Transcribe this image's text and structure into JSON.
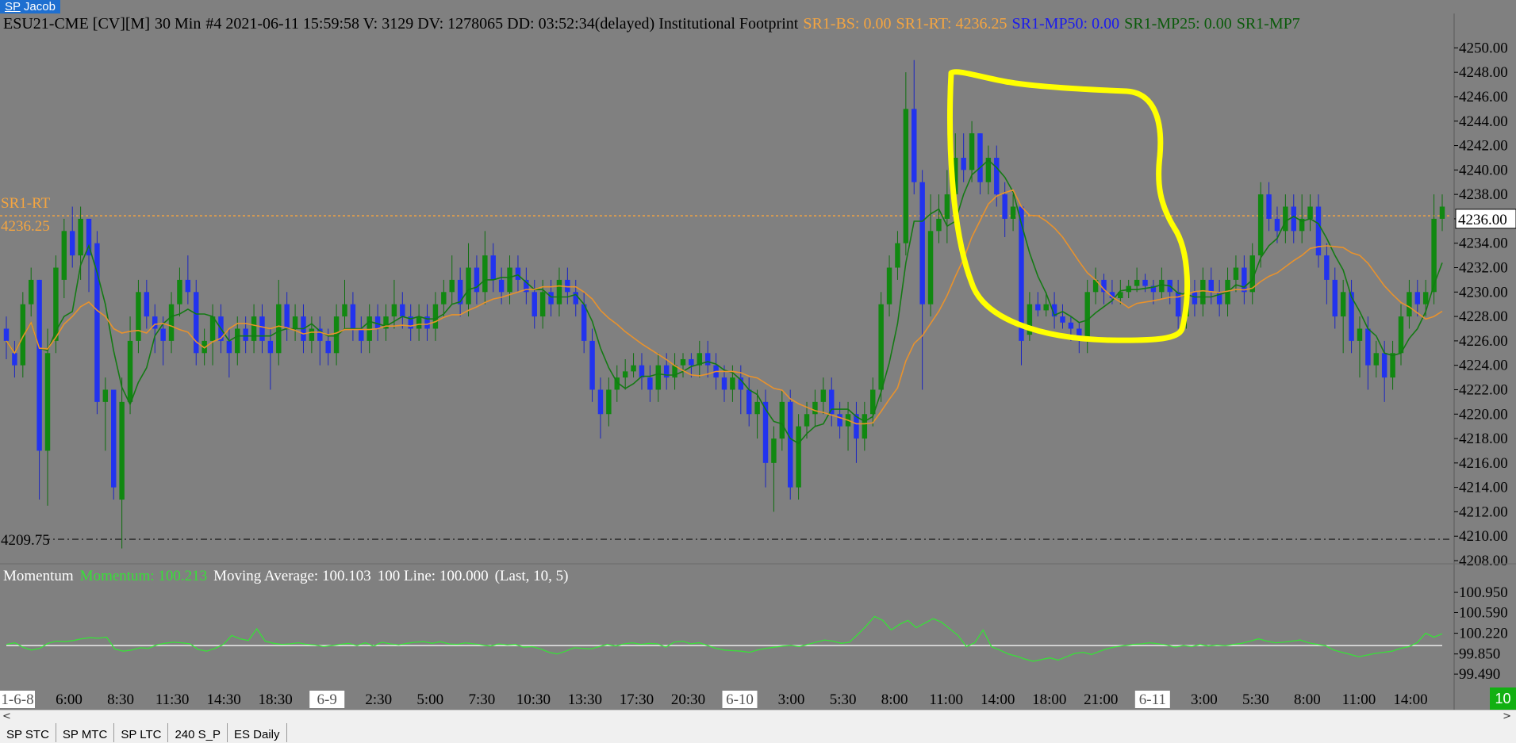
{
  "tab_title": {
    "prefix": "SP",
    "name": "Jacob"
  },
  "header": {
    "symbol": "ESU21-CME [CV][M]",
    "interval": "30 Min",
    "info": "#4 2021-06-11 15:59:58 V: 3129 DV: 1278065 DD: 03:52:34(delayed) Institutional Footprint",
    "sr1_bs": "SR1-BS: 0.00",
    "sr1_rt": "SR1-RT: 4236.25",
    "sr1_mp50": "SR1-MP50: 0.00",
    "sr1_mp25": "SR1-MP25: 0.00",
    "sr1_mp7": "SR1-MP7"
  },
  "colors": {
    "background": "#808080",
    "up_candle": "#118811",
    "down_candle": "#2233ee",
    "fast_ma": "#147a14",
    "slow_ma": "#e8922c",
    "sr_line": "#f5a540",
    "momentum_line": "#38e038",
    "annotation": "#ffff00"
  },
  "price_axis": {
    "min": 4208,
    "max": 4251,
    "labels": [
      "4250.00",
      "4248.00",
      "4246.00",
      "4244.00",
      "4242.00",
      "4240.00",
      "4238.00",
      "4236.00",
      "4234.00",
      "4232.00",
      "4230.00",
      "4228.00",
      "4226.00",
      "4224.00",
      "4222.00",
      "4220.00",
      "4218.00",
      "4216.00",
      "4214.00",
      "4212.00",
      "4210.00",
      "4208.00"
    ],
    "current_price": "4236.00"
  },
  "levels": {
    "sr_rt_label": "SR1-RT",
    "sr_rt_value": "4236.25",
    "sr_rt_price": 4236.25,
    "support_label": "4209.75",
    "support_price": 4209.75
  },
  "momentum": {
    "title": "Momentum",
    "value_label": "Momentum: 100.213",
    "ma_label": "Moving Average: 100.103",
    "line_label": "100 Line: 100.000",
    "params": "(Last, 10, 5)",
    "axis_labels": [
      "100.950",
      "100.590",
      "100.220",
      "99.850",
      "99.490"
    ],
    "min": 99.35,
    "max": 101.05,
    "baseline": 100.0
  },
  "time_axis": {
    "labels": [
      {
        "text": "1-6-8",
        "boxed": true
      },
      {
        "text": "6:00",
        "boxed": false
      },
      {
        "text": "8:30",
        "boxed": false
      },
      {
        "text": "11:30",
        "boxed": false
      },
      {
        "text": "14:30",
        "boxed": false
      },
      {
        "text": "18:30",
        "boxed": false
      },
      {
        "text": "6-9",
        "boxed": true
      },
      {
        "text": "2:30",
        "boxed": false
      },
      {
        "text": "5:00",
        "boxed": false
      },
      {
        "text": "7:30",
        "boxed": false
      },
      {
        "text": "10:30",
        "boxed": false
      },
      {
        "text": "13:30",
        "boxed": false
      },
      {
        "text": "17:30",
        "boxed": false
      },
      {
        "text": "20:30",
        "boxed": false
      },
      {
        "text": "6-10",
        "boxed": true
      },
      {
        "text": "3:00",
        "boxed": false
      },
      {
        "text": "5:30",
        "boxed": false
      },
      {
        "text": "8:00",
        "boxed": false
      },
      {
        "text": "11:00",
        "boxed": false
      },
      {
        "text": "14:00",
        "boxed": false
      },
      {
        "text": "18:00",
        "boxed": false
      },
      {
        "text": "21:00",
        "boxed": false
      },
      {
        "text": "6-11",
        "boxed": true
      },
      {
        "text": "3:00",
        "boxed": false
      },
      {
        "text": "5:30",
        "boxed": false
      },
      {
        "text": "8:00",
        "boxed": false
      },
      {
        "text": "11:00",
        "boxed": false
      },
      {
        "text": "14:00",
        "boxed": false
      }
    ]
  },
  "chart_data": {
    "type": "candlestick",
    "bars": [
      [
        4227,
        4226,
        4228,
        4224.5
      ],
      [
        4225,
        4224,
        4226,
        4223
      ],
      [
        4224,
        4229,
        4230,
        4223
      ],
      [
        4229,
        4231,
        4232,
        4228
      ],
      [
        4231,
        4217,
        4231,
        4213
      ],
      [
        4217,
        4225,
        4227,
        4212.5
      ],
      [
        4226,
        4232,
        4233,
        4225
      ],
      [
        4231,
        4235,
        4236,
        4229.5
      ],
      [
        4235,
        4233,
        4237,
        4232
      ],
      [
        4233,
        4236,
        4237,
        4231
      ],
      [
        4236,
        4233,
        4235,
        4230
      ],
      [
        4234,
        4221,
        4235,
        4220
      ],
      [
        4221,
        4222,
        4223,
        4217
      ],
      [
        4222,
        4214,
        4222,
        4213
      ],
      [
        4213,
        4221,
        4223,
        4209
      ],
      [
        4221,
        4226,
        4228,
        4220
      ],
      [
        4226,
        4230,
        4231,
        4225
      ],
      [
        4230,
        4228,
        4231,
        4227
      ],
      [
        4228,
        4227,
        4229,
        4225
      ],
      [
        4227,
        4226,
        4228,
        4224
      ],
      [
        4226,
        4229,
        4230,
        4225
      ],
      [
        4229,
        4231,
        4232,
        4228
      ],
      [
        4231,
        4230,
        4233,
        4229
      ],
      [
        4230,
        4225,
        4231,
        4224
      ],
      [
        4225,
        4226,
        4227,
        4224
      ],
      [
        4226,
        4228,
        4229,
        4224
      ],
      [
        4228,
        4226,
        4229,
        4225
      ],
      [
        4226,
        4225,
        4227,
        4223
      ],
      [
        4225,
        4227,
        4228,
        4224
      ],
      [
        4227,
        4226,
        4228,
        4225
      ],
      [
        4226,
        4228,
        4229,
        4225
      ],
      [
        4228,
        4226,
        4229,
        4225
      ],
      [
        4226,
        4225,
        4227,
        4222
      ],
      [
        4225,
        4229,
        4231,
        4224
      ],
      [
        4229,
        4227,
        4230,
        4226
      ],
      [
        4227,
        4228,
        4229,
        4226
      ],
      [
        4228,
        4226,
        4229,
        4225
      ],
      [
        4226,
        4227,
        4228,
        4225
      ],
      [
        4227,
        4226,
        4228,
        4224
      ],
      [
        4226,
        4225,
        4227,
        4224
      ],
      [
        4225,
        4228,
        4229,
        4224
      ],
      [
        4228,
        4229,
        4231,
        4227
      ],
      [
        4229,
        4227,
        4230,
        4226
      ],
      [
        4227,
        4226,
        4228,
        4225
      ],
      [
        4226,
        4228,
        4229,
        4225
      ],
      [
        4228,
        4227,
        4229,
        4226
      ],
      [
        4227,
        4228,
        4229,
        4226
      ],
      [
        4228,
        4229,
        4231,
        4227
      ],
      [
        4229,
        4228,
        4230,
        4227
      ],
      [
        4228,
        4227,
        4229,
        4226
      ],
      [
        4227,
        4228,
        4229,
        4226
      ],
      [
        4228,
        4227,
        4229,
        4226
      ],
      [
        4227,
        4229,
        4230,
        4226
      ],
      [
        4229,
        4230,
        4231,
        4228
      ],
      [
        4230,
        4231,
        4233,
        4229
      ],
      [
        4231,
        4229,
        4232,
        4228
      ],
      [
        4229,
        4232,
        4234,
        4228
      ],
      [
        4232,
        4230,
        4233,
        4229
      ],
      [
        4230,
        4233,
        4235,
        4229
      ],
      [
        4233,
        4231,
        4234,
        4230
      ],
      [
        4231,
        4230,
        4232,
        4229
      ],
      [
        4230,
        4232,
        4233,
        4229
      ],
      [
        4232,
        4231,
        4233,
        4230
      ],
      [
        4231,
        4230,
        4232,
        4229
      ],
      [
        4230,
        4228,
        4231,
        4227
      ],
      [
        4228,
        4230,
        4231,
        4227
      ],
      [
        4230,
        4229,
        4231,
        4228
      ],
      [
        4229,
        4231,
        4232,
        4228
      ],
      [
        4231,
        4230,
        4232,
        4229
      ],
      [
        4230,
        4229,
        4231,
        4228
      ],
      [
        4229,
        4226,
        4230,
        4225
      ],
      [
        4226,
        4222,
        4227,
        4221
      ],
      [
        4222,
        4220,
        4223,
        4218
      ],
      [
        4220,
        4222,
        4223,
        4219
      ],
      [
        4222,
        4223,
        4224,
        4221
      ],
      [
        4223,
        4223.5,
        4224.5,
        4222
      ],
      [
        4223.5,
        4224,
        4225,
        4223
      ],
      [
        4224,
        4223,
        4225,
        4222
      ],
      [
        4223,
        4222,
        4224,
        4221
      ],
      [
        4222,
        4224,
        4225,
        4221
      ],
      [
        4224,
        4223,
        4225,
        4222
      ],
      [
        4223,
        4224,
        4225,
        4222
      ],
      [
        4224,
        4224.5,
        4225,
        4223
      ],
      [
        4224.5,
        4224,
        4225,
        4223
      ],
      [
        4224,
        4225,
        4226,
        4223
      ],
      [
        4225,
        4224,
        4226,
        4223
      ],
      [
        4224,
        4223,
        4225,
        4222
      ],
      [
        4223,
        4222,
        4224,
        4221
      ],
      [
        4222,
        4223,
        4224,
        4221
      ],
      [
        4223,
        4222,
        4224,
        4220
      ],
      [
        4222,
        4220,
        4223,
        4219
      ],
      [
        4220,
        4221,
        4222,
        4218
      ],
      [
        4221,
        4216,
        4222,
        4214
      ],
      [
        4216,
        4218,
        4219,
        4212
      ],
      [
        4218,
        4221,
        4222,
        4217
      ],
      [
        4221,
        4214,
        4222,
        4213
      ],
      [
        4214,
        4219,
        4220,
        4213
      ],
      [
        4219,
        4220,
        4221,
        4218
      ],
      [
        4220,
        4221,
        4222,
        4219
      ],
      [
        4221,
        4222,
        4223,
        4220
      ],
      [
        4222,
        4220,
        4223,
        4219
      ],
      [
        4220,
        4219,
        4221,
        4218
      ],
      [
        4219,
        4220,
        4221,
        4217
      ],
      [
        4220,
        4218,
        4221,
        4216
      ],
      [
        4218,
        4220,
        4221,
        4217
      ],
      [
        4220,
        4222,
        4223,
        4219
      ],
      [
        4222,
        4229,
        4230,
        4221
      ],
      [
        4229,
        4232,
        4233,
        4228
      ],
      [
        4232,
        4234,
        4235,
        4231
      ],
      [
        4234,
        4245,
        4248,
        4233
      ],
      [
        4245,
        4239,
        4249,
        4238
      ],
      [
        4239,
        4229,
        4240,
        4222
      ],
      [
        4229,
        4235,
        4238,
        4228
      ],
      [
        4235,
        4236,
        4238,
        4234
      ],
      [
        4236,
        4238,
        4240,
        4234
      ],
      [
        4238,
        4241,
        4243,
        4236
      ],
      [
        4241,
        4240,
        4243,
        4239
      ],
      [
        4240,
        4243,
        4244,
        4239
      ],
      [
        4243,
        4239,
        4243,
        4238
      ],
      [
        4239,
        4241,
        4242,
        4238
      ],
      [
        4241,
        4238,
        4242,
        4237
      ],
      [
        4238,
        4236,
        4239,
        4234.5
      ],
      [
        4236,
        4237,
        4238,
        4235
      ],
      [
        4237,
        4226,
        4237,
        4224
      ],
      [
        4226.5,
        4229,
        4230,
        4226
      ],
      [
        4229,
        4228.5,
        4230,
        4228
      ],
      [
        4228.5,
        4229,
        4230,
        4228
      ],
      [
        4229,
        4228,
        4230,
        4227
      ],
      [
        4228,
        4227.5,
        4229,
        4227
      ],
      [
        4227.5,
        4227,
        4228,
        4226
      ],
      [
        4227,
        4226,
        4227.5,
        4225
      ],
      [
        4226,
        4230,
        4231,
        4225
      ],
      [
        4230,
        4231,
        4232,
        4229
      ],
      [
        4231,
        4230,
        4231.5,
        4229
      ],
      [
        4230,
        4229.5,
        4231,
        4229
      ],
      [
        4229.5,
        4230,
        4231,
        4229
      ],
      [
        4230,
        4230.5,
        4231,
        4229.5
      ],
      [
        4230.5,
        4231,
        4232,
        4230
      ],
      [
        4231,
        4230.5,
        4231.5,
        4230
      ],
      [
        4230.5,
        4230,
        4231,
        4229
      ],
      [
        4230,
        4231,
        4232,
        4229.5
      ],
      [
        4231,
        4230,
        4231,
        4229
      ],
      [
        4230,
        4228,
        4231,
        4227
      ],
      [
        4228,
        4230,
        4231,
        4227
      ],
      [
        4230,
        4229,
        4231,
        4228
      ],
      [
        4229,
        4231,
        4232,
        4228
      ],
      [
        4231,
        4230,
        4232,
        4229
      ],
      [
        4230,
        4229,
        4231,
        4228
      ],
      [
        4229,
        4231,
        4232,
        4228
      ],
      [
        4231,
        4232,
        4233,
        4230
      ],
      [
        4232,
        4230,
        4233,
        4229
      ],
      [
        4230,
        4233,
        4234,
        4229
      ],
      [
        4233,
        4238,
        4239,
        4232
      ],
      [
        4238,
        4236,
        4239,
        4235
      ],
      [
        4236,
        4235,
        4237,
        4234
      ],
      [
        4235,
        4237,
        4238,
        4234
      ],
      [
        4237,
        4235,
        4238,
        4234
      ],
      [
        4235,
        4236,
        4238,
        4234
      ],
      [
        4236,
        4237,
        4238,
        4235
      ],
      [
        4237,
        4233,
        4238,
        4232
      ],
      [
        4233,
        4231,
        4234,
        4229
      ],
      [
        4231,
        4228,
        4232,
        4227
      ],
      [
        4228,
        4230,
        4231,
        4225
      ],
      [
        4230,
        4226,
        4231,
        4225
      ],
      [
        4226,
        4227,
        4228,
        4223
      ],
      [
        4227,
        4224,
        4228,
        4222
      ],
      [
        4224,
        4225,
        4226,
        4223
      ],
      [
        4225,
        4223,
        4226,
        4221
      ],
      [
        4223,
        4225,
        4226,
        4222
      ],
      [
        4225,
        4228,
        4229,
        4224
      ],
      [
        4228,
        4230,
        4231,
        4227
      ],
      [
        4230,
        4229,
        4231,
        4228
      ],
      [
        4229,
        4230,
        4231,
        4228
      ],
      [
        4230,
        4236,
        4238,
        4229
      ],
      [
        4236,
        4237,
        4238,
        4235
      ]
    ],
    "momentum": [
      100.02,
      100.05,
      99.97,
      99.92,
      99.95,
      100.04,
      100.08,
      100.07,
      100.09,
      100.12,
      100.14,
      100.13,
      100.15,
      99.94,
      99.9,
      99.92,
      99.96,
      99.95,
      100.01,
      100.04,
      100.06,
      100.05,
      100.03,
      99.93,
      99.9,
      99.95,
      100.02,
      100.18,
      100.12,
      100.09,
      100.3,
      100.08,
      100.04,
      100.02,
      100.03,
      100.05,
      100.02,
      100.01,
      99.98,
      100.0,
      100.02,
      100.04,
      100.0,
      100.05,
      99.99,
      100.06,
      100.03,
      100.01,
      100.04,
      100.06,
      100.07,
      100.04,
      100.07,
      100.03,
      100.02,
      100.05,
      100.03,
      100.01,
      99.99,
      100.03,
      100.01,
      100.02,
      99.97,
      99.98,
      99.94,
      99.88,
      99.85,
      99.9,
      99.96,
      99.95,
      99.94,
      99.98,
      100.02,
      99.99,
      100.03,
      100.05,
      100.02,
      100.04,
      100.03,
      99.97,
      100.06,
      100.08,
      100.03,
      100.05,
      100.0,
      99.95,
      99.92,
      99.91,
      99.9,
      99.88,
      99.92,
      99.95,
      99.97,
      99.99,
      100.0,
      99.98,
      100.02,
      100.06,
      100.1,
      100.08,
      100.04,
      100.06,
      100.2,
      100.35,
      100.52,
      100.45,
      100.28,
      100.38,
      100.45,
      100.32,
      100.4,
      100.48,
      100.42,
      100.3,
      100.18,
      99.98,
      100.05,
      100.28,
      99.98,
      99.92,
      99.85,
      99.81,
      99.76,
      99.72,
      99.75,
      99.78,
      99.74,
      99.8,
      99.86,
      99.88,
      99.84,
      99.9,
      99.95,
      99.98,
      100.0,
      100.02,
      100.03,
      100.05,
      100.03,
      100.01,
      99.97,
      100.0,
      99.98,
      100.02,
      99.99,
      100.01,
      100.0,
      100.02,
      100.04,
      100.08,
      100.12,
      100.08,
      100.05,
      100.06,
      100.08,
      100.1,
      100.05,
      100.02,
      100.0,
      99.92,
      99.88,
      99.84,
      99.8,
      99.83,
      99.86,
      99.88,
      99.9,
      99.95,
      99.98,
      100.05,
      100.22,
      100.15,
      100.21
    ],
    "series": [
      {
        "name": "SR1-RT",
        "value": 4236.25
      }
    ]
  },
  "status": {
    "corner_value": "10"
  },
  "tabs": [
    "SP STC",
    "SP MTC",
    "SP LTC",
    "240 S_P",
    "ES Daily"
  ]
}
